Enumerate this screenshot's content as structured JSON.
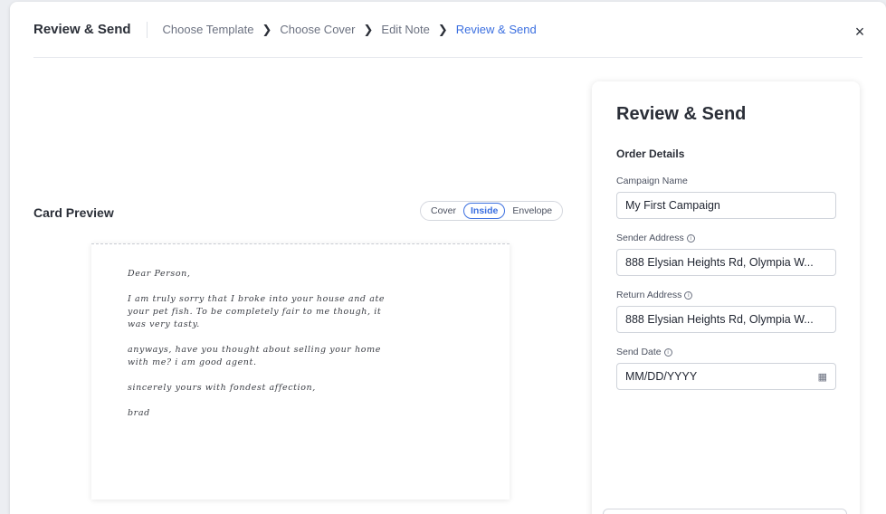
{
  "header": {
    "title": "Review & Send",
    "steps": [
      "Choose Template",
      "Choose Cover",
      "Edit Note",
      "Review & Send"
    ],
    "active_step": 3,
    "close_glyph": "×"
  },
  "preview": {
    "label": "Card Preview",
    "views": [
      "Cover",
      "Inside",
      "Envelope"
    ],
    "active_view": "Inside",
    "note": [
      "Dear Person,",
      "I am truly sorry that I broke into your house and ate\nyour pet fish. To be completely fair to me though, it\nwas very tasty.",
      "anyways, have you thought about selling your home\nwith me? i am good agent.",
      "sincerely yours with fondest affection,",
      "brad"
    ]
  },
  "order": {
    "title": "Review & Send",
    "section": "Order Details",
    "campaign_label": "Campaign Name",
    "campaign_value": "My First Campaign",
    "sender_label": "Sender Address",
    "sender_value": "888 Elysian Heights Rd, Olympia W...",
    "return_label": "Return Address",
    "return_value": "888 Elysian Heights Rd, Olympia W...",
    "date_label": "Send Date",
    "date_placeholder": "MM/DD/YYYY"
  },
  "icons": {
    "info": "i",
    "calendar": "▦"
  },
  "colors": {
    "accent": "#3b6fe0"
  }
}
